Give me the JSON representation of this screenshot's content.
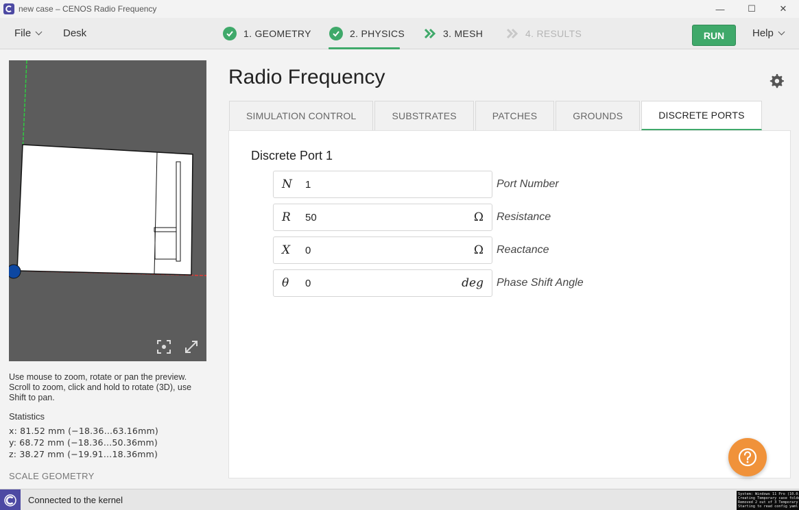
{
  "window": {
    "title": "new case – CENOS Radio Frequency",
    "minimize": "—",
    "maximize": "☐",
    "close": "✕"
  },
  "menu": {
    "file": "File",
    "desk": "Desk",
    "help": "Help",
    "run": "RUN"
  },
  "steps": [
    {
      "label": "1. GEOMETRY",
      "state": "done"
    },
    {
      "label": "2. PHYSICS",
      "state": "done-active"
    },
    {
      "label": "3. MESH",
      "state": "next"
    },
    {
      "label": "4. RESULTS",
      "state": "disabled"
    }
  ],
  "left": {
    "hint": "Use mouse to zoom, rotate or pan the preview. Scroll to zoom, click and hold to rotate (3D), use Shift to pan.",
    "stats_title": "Statistics",
    "stats": [
      "x: 81.52 mm  (−18.36…63.16mm)",
      "y: 68.72 mm  (−18.36…50.36mm)",
      "z: 38.27 mm  (−19.91…18.36mm)"
    ],
    "scale_geometry": "SCALE GEOMETRY"
  },
  "page": {
    "title": "Radio Frequency"
  },
  "tabs": [
    {
      "label": "SIMULATION CONTROL",
      "active": false
    },
    {
      "label": "SUBSTRATES",
      "active": false
    },
    {
      "label": "PATCHES",
      "active": false
    },
    {
      "label": "GROUNDS",
      "active": false
    },
    {
      "label": "DISCRETE PORTS",
      "active": true
    }
  ],
  "port": {
    "title": "Discrete Port 1",
    "fields": [
      {
        "symbol": "N",
        "value": "1",
        "unit": "",
        "label": "Port Number"
      },
      {
        "symbol": "R",
        "value": "50",
        "unit": "Ω",
        "label": "Resistance"
      },
      {
        "symbol": "X",
        "value": "0",
        "unit": "Ω",
        "label": "Reactance"
      },
      {
        "symbol": "θ",
        "value": "0",
        "unit": "deg",
        "label": "Phase Shift Angle"
      }
    ]
  },
  "status": {
    "text": "Connected to the kernel",
    "terminal": [
      "System: Windows 11 Pro (10.0.",
      "Creating Temporary case folde",
      "Removed 2 out of 3 Temporary",
      "Starting to read config yaml"
    ]
  },
  "colors": {
    "accent_green": "#3fa96a",
    "help_orange": "#f0923a",
    "brand_purple": "#4d4aa3"
  }
}
